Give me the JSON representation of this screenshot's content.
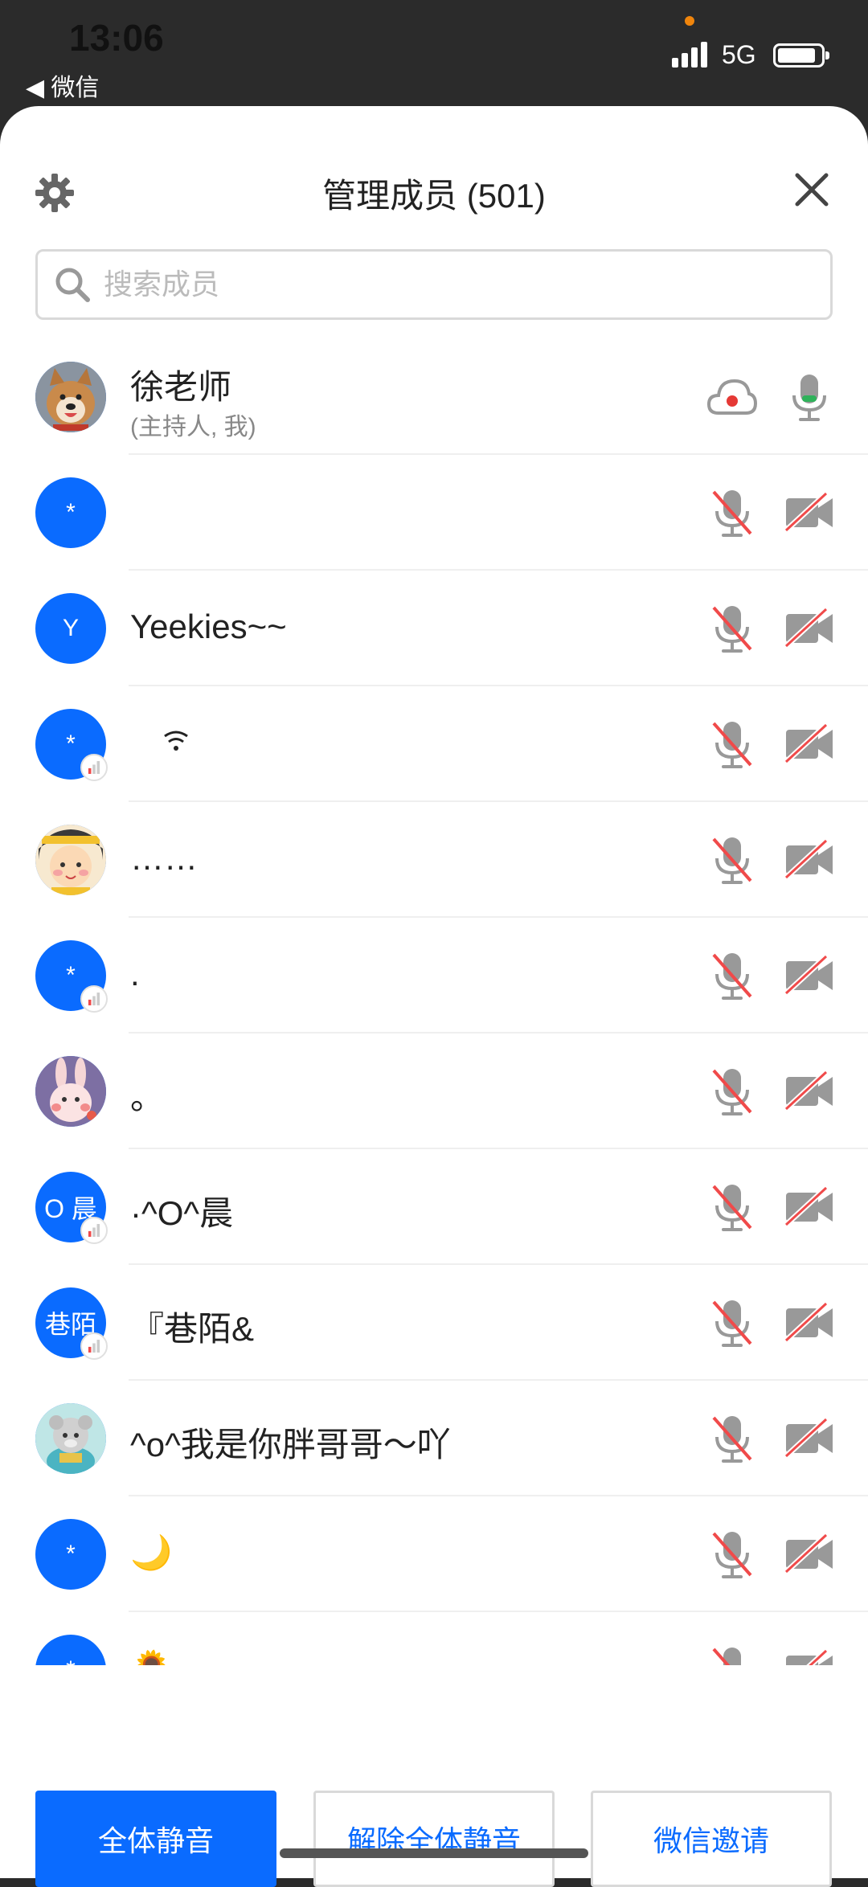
{
  "status_bar": {
    "time": "13:06",
    "back_label": "◀ 微信",
    "network": "5G",
    "battery_level": 0.88
  },
  "header": {
    "title": "管理成员 (501)"
  },
  "search": {
    "placeholder": "搜索成员",
    "value": ""
  },
  "members": [
    {
      "name": "徐老师",
      "subtitle": "(主持人, 我)",
      "avatar": "dog-photo",
      "mic": "on",
      "cam": "cloud"
    },
    {
      "name": "",
      "avatar_text": "*",
      "mic": "muted",
      "cam": "off"
    },
    {
      "name": " Yeekies~~",
      "avatar_text": "Y",
      "mic": "muted",
      "cam": "off"
    },
    {
      "name": "",
      "avatar_text": "*",
      "signal_badge": true,
      "name_icon": "wifi",
      "mic": "muted",
      "cam": "off"
    },
    {
      "name": "……",
      "avatar": "cartoon-girl",
      "mic": "muted",
      "cam": "off"
    },
    {
      "name": ".",
      "avatar_text": "*",
      "signal_badge": true,
      "mic": "muted",
      "cam": "off"
    },
    {
      "name": "。",
      "avatar": "bunny",
      "mic": "muted",
      "cam": "off"
    },
    {
      "name": "·^O^晨",
      "avatar_text": "O 晨",
      "signal_badge": true,
      "mic": "muted",
      "cam": "off"
    },
    {
      "name": " 『巷陌&",
      "avatar_text": "巷陌",
      "signal_badge": true,
      "mic": "muted",
      "cam": "off"
    },
    {
      "name": "^o^我是你胖哥哥～吖",
      "avatar": "toy-figure",
      "mic": "muted",
      "cam": "off"
    },
    {
      "name": "🌙",
      "avatar_text": "*",
      "mic": "muted",
      "cam": "off"
    },
    {
      "name": "🌻",
      "avatar_text": "*",
      "mic": "muted",
      "cam": "off"
    }
  ],
  "footer": {
    "mute_all": "全体静音",
    "unmute_all": "解除全体静音",
    "wechat_invite": "微信邀请"
  },
  "colors": {
    "accent": "#0a6bff",
    "muted_slash": "#f04a4a",
    "mic_active": "#2fb25a",
    "record_dot": "#e53935"
  }
}
